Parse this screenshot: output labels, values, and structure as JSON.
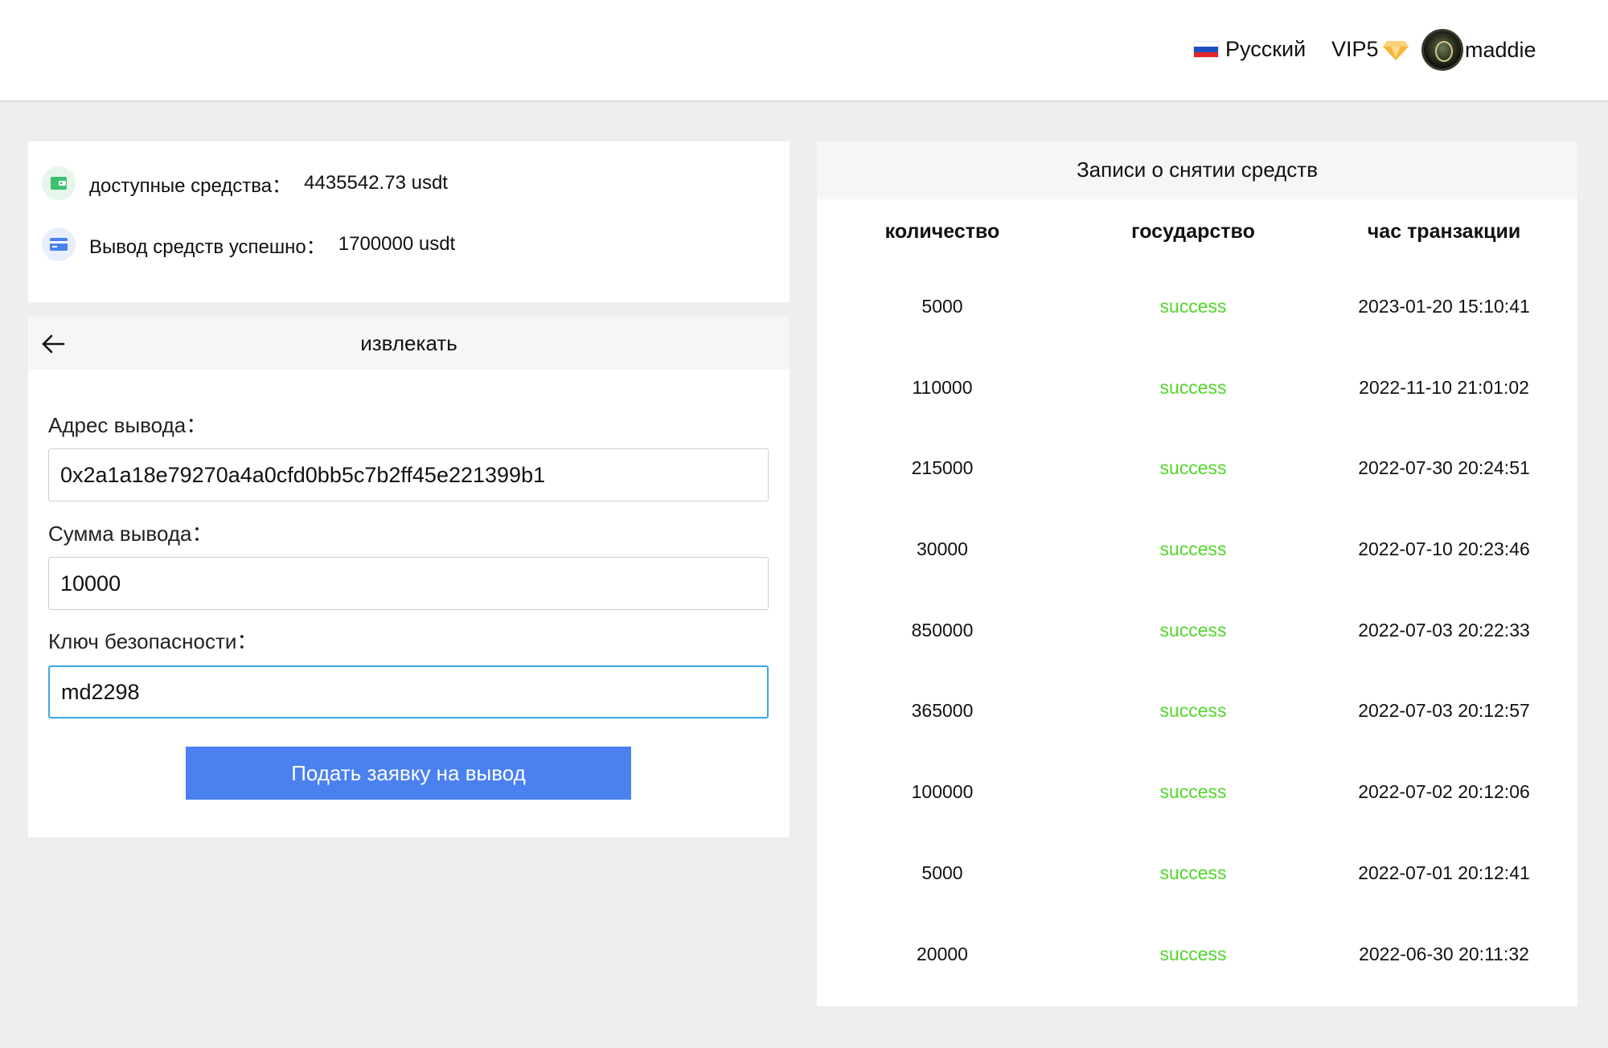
{
  "header": {
    "language": "Русский",
    "vip": "VIP5",
    "username": "maddie",
    "flag_colors": [
      "#ffffff",
      "#1f4fc4",
      "#e2262b"
    ],
    "diamond_color": "#f6b53a"
  },
  "balance": {
    "available_label": "доступные средства：",
    "available_value": "4435542.73 usdt",
    "withdrawn_label": "Вывод средств успешно：",
    "withdrawn_value": "1700000 usdt",
    "wallet_icon_color": "#3fbf6f",
    "card_icon_color": "#4a80f0"
  },
  "withdraw": {
    "title": "извлекать",
    "address_label": "Адрес вывода：",
    "address_value": "0x2a1a18e79270a4a0cfd0bb5c7b2ff45e221399b1",
    "amount_label": "Сумма вывода：",
    "amount_value": "10000",
    "key_label": "Ключ безопасности：",
    "key_value": "md2298",
    "submit_label": "Подать заявку на вывод",
    "accent_color": "#4a80f0"
  },
  "records": {
    "title": "Записи о снятии средств",
    "columns": [
      "количество",
      "государство",
      "час транзакции"
    ],
    "rows": [
      {
        "amount": "5000",
        "status": "success",
        "time": "2023-01-20 15:10:41"
      },
      {
        "amount": "110000",
        "status": "success",
        "time": "2022-11-10 21:01:02"
      },
      {
        "amount": "215000",
        "status": "success",
        "time": "2022-07-30 20:24:51"
      },
      {
        "amount": "30000",
        "status": "success",
        "time": "2022-07-10 20:23:46"
      },
      {
        "amount": "850000",
        "status": "success",
        "time": "2022-07-03 20:22:33"
      },
      {
        "amount": "365000",
        "status": "success",
        "time": "2022-07-03 20:12:57"
      },
      {
        "amount": "100000",
        "status": "success",
        "time": "2022-07-02 20:12:06"
      },
      {
        "amount": "5000",
        "status": "success",
        "time": "2022-07-01 20:12:41"
      },
      {
        "amount": "20000",
        "status": "success",
        "time": "2022-06-30 20:11:32"
      }
    ],
    "status_color": "#52d62a"
  }
}
